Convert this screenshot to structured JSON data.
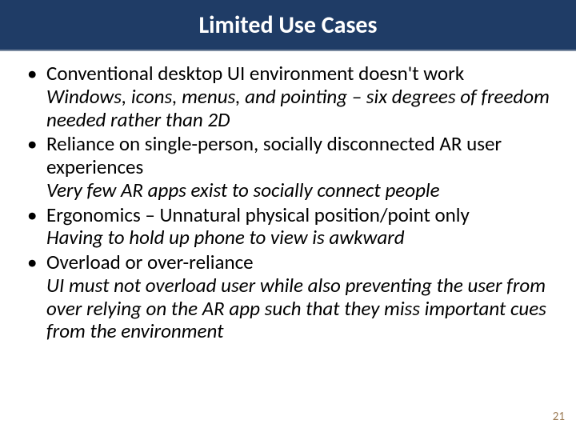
{
  "title": "Limited Use Cases",
  "bullets": [
    {
      "main": "Conventional desktop UI environment doesn't work",
      "sub": "Windows, icons, menus, and pointing – six degrees of freedom needed rather than 2D"
    },
    {
      "main": "Reliance on single-person, socially disconnected AR user experiences",
      "sub": "Very few AR apps exist to socially connect people"
    },
    {
      "main": "Ergonomics – Unnatural physical position/point only",
      "sub": "Having to hold up phone to view is awkward"
    },
    {
      "main": "Overload or over-reliance",
      "sub": "UI must not overload user while also preventing the user from over relying on the AR app such that they miss important cues from the environment"
    }
  ],
  "page_number": "21"
}
